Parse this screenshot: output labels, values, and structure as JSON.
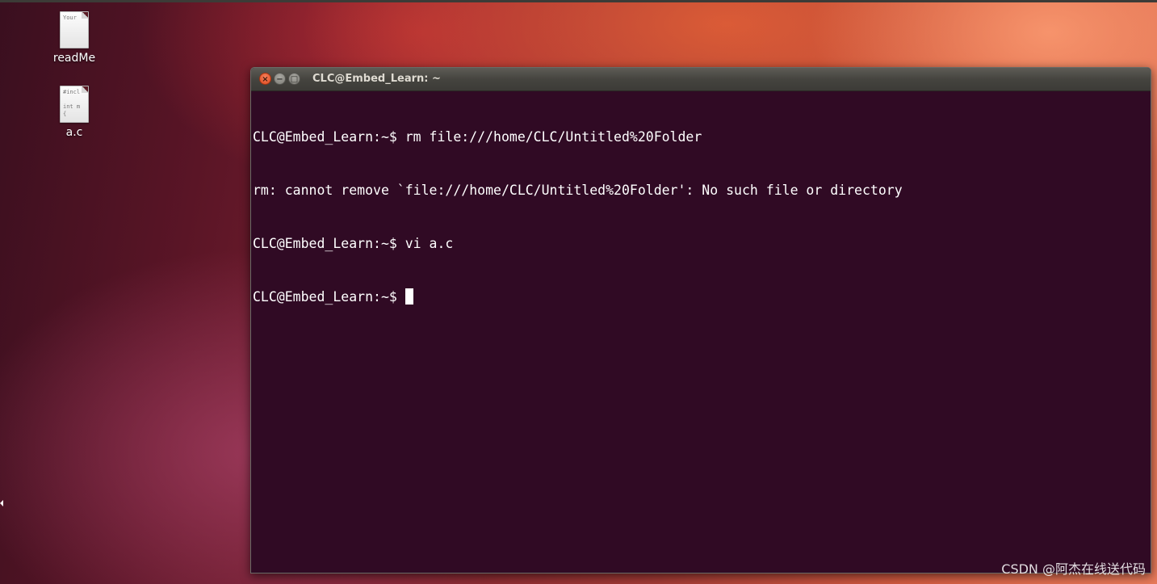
{
  "desktop": {
    "icons": [
      {
        "label": "readMe",
        "preview": "Your",
        "icon": "text-file-icon"
      },
      {
        "label": "a.c",
        "preview": "#incl\n\nint m\n{",
        "icon": "c-source-file-icon"
      }
    ]
  },
  "terminal": {
    "title": "CLC@Embed_Learn: ~",
    "buttons": {
      "close": "×",
      "minimize": "−",
      "maximize": "□"
    },
    "lines": [
      "CLC@Embed_Learn:~$ rm file:///home/CLC/Untitled%20Folder",
      "rm: cannot remove `file:///home/CLC/Untitled%20Folder': No such file or directory",
      "CLC@Embed_Learn:~$ vi a.c"
    ],
    "prompt": "CLC@Embed_Learn:~$"
  },
  "watermark": "CSDN @阿杰在线送代码",
  "colors": {
    "terminal_bg": "#300a24",
    "close_button": "#df4a1f",
    "text": "#ffffff"
  }
}
